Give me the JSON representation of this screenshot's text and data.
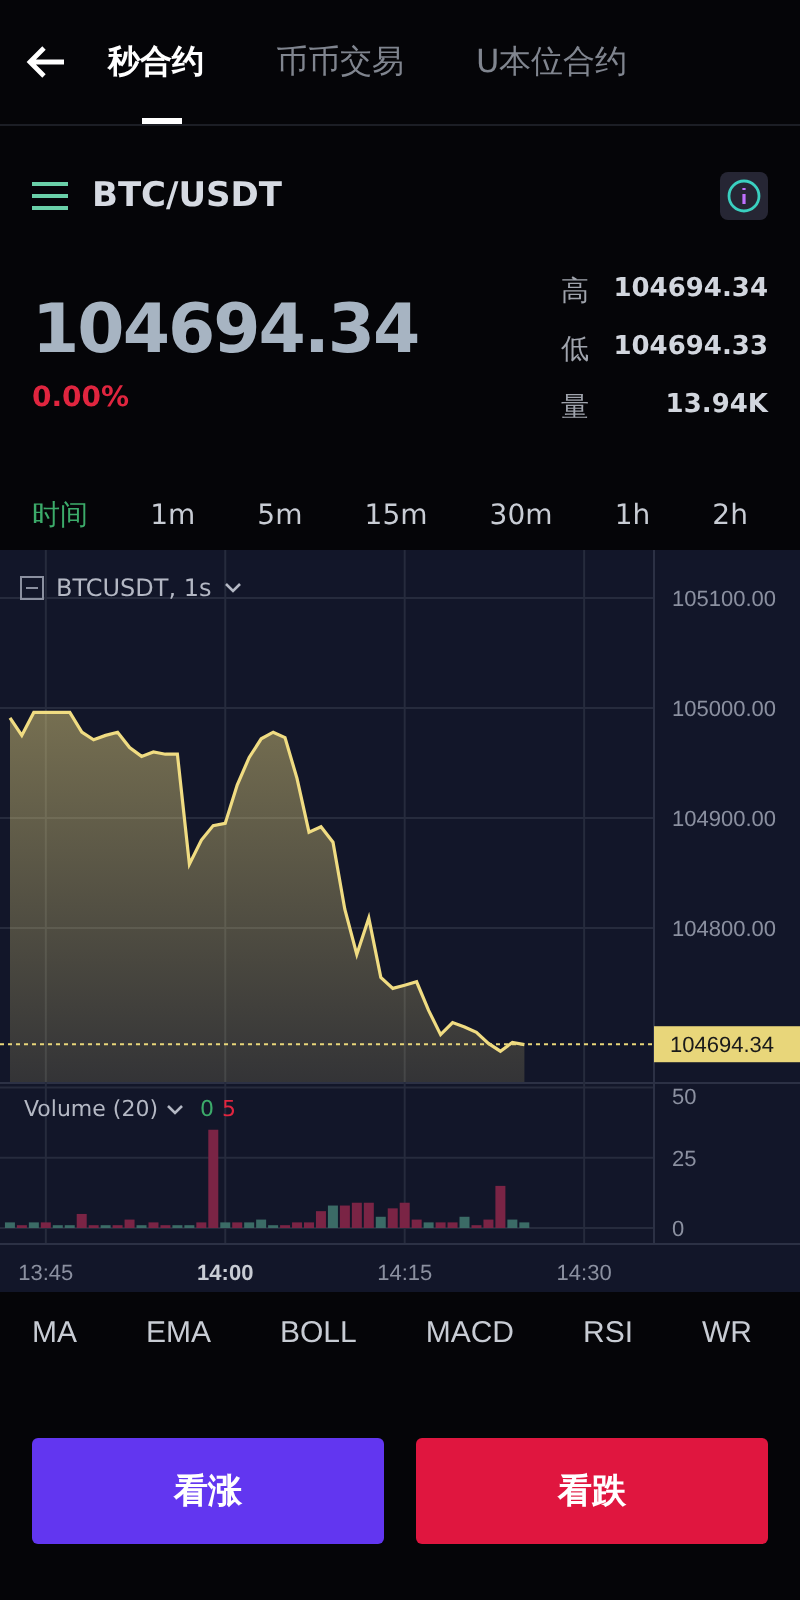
{
  "nav": {
    "tabs": [
      {
        "label": "秒合约",
        "selected": true
      },
      {
        "label": "币币交易",
        "selected": false
      },
      {
        "label": "U本位合约",
        "selected": false
      }
    ]
  },
  "symbol": {
    "name": "BTC/USDT"
  },
  "ticker": {
    "price": "104694.34",
    "change": "0.00%",
    "stats": [
      {
        "label": "高",
        "value": "104694.34"
      },
      {
        "label": "低",
        "value": "104694.33"
      },
      {
        "label": "量",
        "value": "13.94K"
      }
    ]
  },
  "intervals": [
    {
      "label": "时间",
      "selected": true
    },
    {
      "label": "1m",
      "selected": false
    },
    {
      "label": "5m",
      "selected": false
    },
    {
      "label": "15m",
      "selected": false
    },
    {
      "label": "30m",
      "selected": false
    },
    {
      "label": "1h",
      "selected": false
    },
    {
      "label": "2h",
      "selected": false
    }
  ],
  "price_chart": {
    "legend": "BTCUSDT, 1s",
    "chart_data": {
      "type": "area",
      "series": [
        {
          "color": "#f0dc82",
          "values": [
            104991,
            104975,
            104996,
            104996,
            104996,
            104996,
            104978,
            104971,
            104975,
            104978,
            104964,
            104956,
            104960,
            104958,
            104958,
            104858,
            104880,
            104893,
            104895,
            104930,
            104955,
            104972,
            104978,
            104973,
            104936,
            104887,
            104892,
            104878,
            104817,
            104776,
            104809,
            104755,
            104745,
            104748,
            104751,
            104725,
            104703,
            104714,
            104710,
            104705,
            104695,
            104688,
            104696,
            104694
          ]
        }
      ],
      "ylim": [
        104660,
        105143.6
      ],
      "yticks": [
        {
          "value": 105100,
          "label": "105100.00"
        },
        {
          "value": 105000,
          "label": "105000.00"
        },
        {
          "value": 104900,
          "label": "104900.00"
        },
        {
          "value": 104800,
          "label": "104800.00"
        }
      ],
      "grid": true,
      "ref_lines": [
        {
          "axis": "y",
          "value": 104694.34,
          "label": "104694.34"
        }
      ]
    }
  },
  "volume_chart": {
    "legend": "Volume (20)",
    "readings": [
      {
        "text": "0",
        "kind": "up"
      },
      {
        "text": "5",
        "kind": "down"
      }
    ],
    "chart_data": {
      "type": "bar",
      "stacked": true,
      "categories": [
        null,
        null,
        null,
        "13:45",
        null,
        null,
        null,
        null,
        null,
        null,
        null,
        null,
        null,
        null,
        null,
        null,
        null,
        null,
        "14:00",
        null,
        null,
        null,
        null,
        null,
        null,
        null,
        null,
        null,
        null,
        null,
        null,
        null,
        null,
        "14:15",
        null,
        null,
        null,
        null,
        null,
        null,
        null,
        null,
        null,
        null,
        null,
        null,
        null,
        null,
        "14:30"
      ],
      "series": [
        {
          "color": "#3b6b66",
          "values": [
            2,
            null,
            2,
            null,
            1,
            1,
            null,
            null,
            1,
            null,
            null,
            1,
            null,
            null,
            1,
            1,
            null,
            null,
            2,
            null,
            2,
            3,
            1,
            null,
            null,
            null,
            null,
            8,
            null,
            null,
            null,
            4,
            null,
            null,
            null,
            2,
            null,
            null,
            4,
            null,
            null,
            null,
            3,
            2,
            null,
            null,
            null,
            null,
            null
          ]
        },
        {
          "color": "#7a2445",
          "values": [
            null,
            1,
            null,
            2,
            null,
            null,
            5,
            1,
            null,
            1,
            3,
            null,
            2,
            1,
            null,
            null,
            2,
            35,
            null,
            2,
            null,
            null,
            null,
            1,
            2,
            2,
            6,
            null,
            8,
            9,
            9,
            null,
            7,
            9,
            3,
            null,
            2,
            2,
            null,
            1,
            3,
            15,
            null,
            null,
            null,
            null,
            null,
            null,
            null
          ]
        }
      ],
      "ylim": [
        0,
        52
      ],
      "yticks": [
        50,
        25,
        0
      ],
      "grid": true
    }
  },
  "indicators": [
    "MA",
    "EMA",
    "BOLL",
    "MACD",
    "RSI",
    "WR"
  ],
  "actions": [
    {
      "label": "看涨",
      "kind": "buy"
    },
    {
      "label": "看跌",
      "kind": "sell"
    }
  ]
}
